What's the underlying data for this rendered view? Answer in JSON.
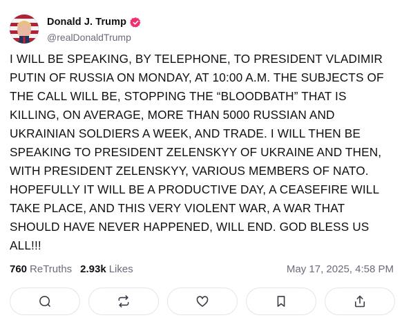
{
  "author": {
    "display_name": "Donald J. Trump",
    "handle": "@realDonaldTrump",
    "verified": true,
    "verified_color": "#f0306e"
  },
  "post": {
    "text": "I WILL BE SPEAKING, BY TELEPHONE, TO PRESIDENT VLADIMIR PUTIN OF RUSSIA ON MONDAY, AT 10:00 A.M. THE SUBJECTS OF THE CALL WILL BE, STOPPING THE “BLOODBATH” THAT IS KILLING, ON AVERAGE, MORE THAN 5000 RUSSIAN AND UKRAINIAN SOLDIERS A WEEK, AND TRADE. I WILL THEN BE SPEAKING TO PRESIDENT ZELENSKYY OF UKRAINE AND THEN, WITH PRESIDENT ZELENSKYY, VARIOUS MEMBERS OF NATO. HOPEFULLY IT WILL BE A PRODUCTIVE DAY, A CEASEFIRE WILL TAKE PLACE, AND THIS VERY VIOLENT WAR, A WAR THAT SHOULD HAVE NEVER HAPPENED, WILL END. GOD BLESS US ALL!!!",
    "retruths_count": "760",
    "retruths_label": "ReTruths",
    "likes_count": "2.93k",
    "likes_label": "Likes",
    "timestamp": "May 17, 2025, 4:58 PM"
  },
  "actions": [
    {
      "icon": "reply-icon"
    },
    {
      "icon": "retruth-icon"
    },
    {
      "icon": "like-icon"
    },
    {
      "icon": "bookmark-icon"
    },
    {
      "icon": "share-icon"
    }
  ],
  "colors": {
    "text": "#0f0f14",
    "muted": "#6b6b7b",
    "border": "#e4e4ea"
  }
}
